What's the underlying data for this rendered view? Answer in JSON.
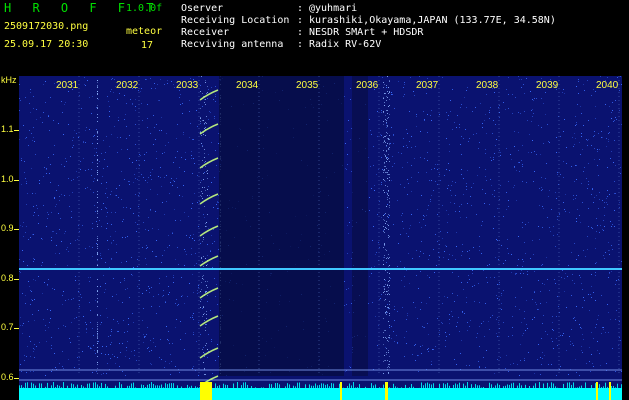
{
  "header": {
    "app_title": "H R O F F T",
    "app_version": "1.0.0f",
    "file_name": "2509172030.png",
    "meteor_label": "meteor",
    "datetime": "25.09.17 20:30",
    "meteor_count": "17"
  },
  "info": [
    {
      "label": "Oserver",
      "sep": ":",
      "value": "@yuhmari"
    },
    {
      "label": "Receiving Location",
      "sep": ":",
      "value": "kurashiki,Okayama,JAPAN (133.77E, 34.58N)"
    },
    {
      "label": "Receiver",
      "sep": ":",
      "value": "NESDR SMArt + HDSDR"
    },
    {
      "label": "Recviving antenna",
      "sep": ":",
      "value": "Radix RV-62V"
    }
  ],
  "spectrogram": {
    "unit": "kHz",
    "y_ticks": [
      "1.1",
      "1.0",
      "0.9",
      "0.8",
      "0.7",
      "0.6"
    ],
    "time_ticks": [
      "2031",
      "2032",
      "2033",
      "2034",
      "2035",
      "2036",
      "2037",
      "2038",
      "2039",
      "2040"
    ],
    "colors": {
      "background": "#0a1270",
      "noise": "#3a6cff",
      "carrier": "#40c8ff",
      "meteor": "#c8ff80",
      "bottom_signal": "#00ffff",
      "peaks": "#ffff00",
      "labels": "#ffff40"
    }
  }
}
